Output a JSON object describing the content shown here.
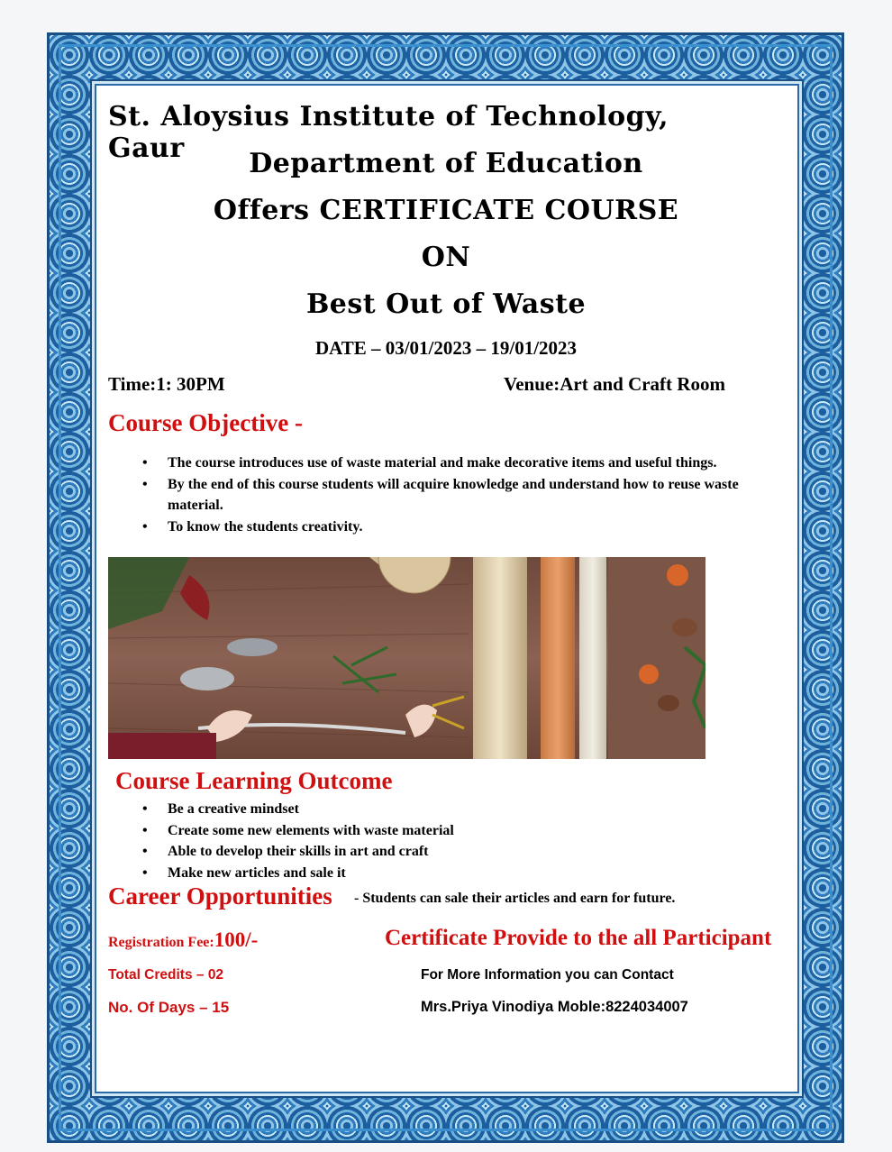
{
  "header": {
    "institute": "St. Aloysius Institute of Technology, Gaur",
    "department": "Department of Education",
    "offer": "Offers CERTIFICATE COURSE",
    "on": "ON",
    "course_title": "Best Out of Waste"
  },
  "date": "DATE – 03/01/2023 – 19/01/2023",
  "time": "Time:1: 30PM",
  "venue": "Venue:Art and Craft Room",
  "objective": {
    "heading": "Course Objective -",
    "items": [
      "The course introduces use of waste material and make decorative items and useful things.",
      "By the end of this course students will acquire knowledge and understand how to reuse waste material.",
      "To know the students creativity."
    ]
  },
  "outcome": {
    "heading": "Course Learning Outcome",
    "items": [
      "Be a creative mindset",
      "Create some new elements with waste material",
      "Able to develop their skills in art and craft",
      "Make new articles and sale it"
    ]
  },
  "career": {
    "heading": "Career Opportunities",
    "separator": " - ",
    "text": "Students can sale their articles and earn for future."
  },
  "registration": {
    "label": "Registration Fee:",
    "fee": "100/-"
  },
  "certificate_note": "Certificate Provide to the all Participant",
  "credits": "Total Credits – 02",
  "days": "No. Of Days – 15",
  "contact": {
    "line1": "For More Information you can Contact",
    "line2": "Mrs.Priya Vinodiya Moble:8224034007"
  },
  "colors": {
    "heading_red": "#d01010",
    "border_blue": "#1d5f9e"
  }
}
